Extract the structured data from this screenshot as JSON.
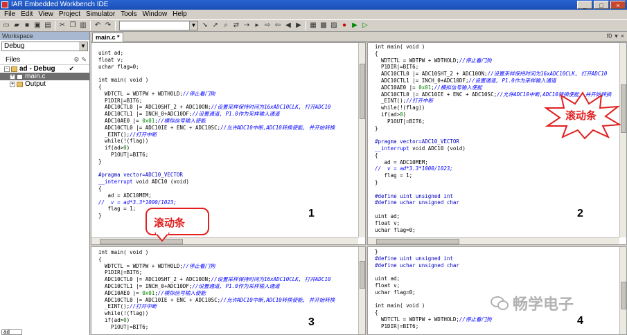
{
  "window": {
    "title": "IAR Embedded Workbench IDE",
    "buttons": [
      "_",
      "□",
      "×"
    ]
  },
  "menu": [
    "File",
    "Edit",
    "View",
    "Project",
    "Simulator",
    "Tools",
    "Window",
    "Help"
  ],
  "workspace": {
    "title": "Workspace",
    "config": "Debug",
    "files_label": "Files",
    "project": "ad - Debug",
    "checkmark": "✔",
    "items": [
      "main.c",
      "Output"
    ],
    "bottom_tab": "ad"
  },
  "editor": {
    "tab_label": "main.c *",
    "tab_tools": [
      "f0",
      "▾",
      "×"
    ]
  },
  "panes": [
    {
      "number": "1"
    },
    {
      "number": "2"
    },
    {
      "number": "3"
    },
    {
      "number": "4"
    }
  ],
  "callouts": {
    "scrollbar_1": "滚动条",
    "scrollbar_2": "滚动条"
  },
  "watermark": {
    "text": "畅学电子"
  }
}
